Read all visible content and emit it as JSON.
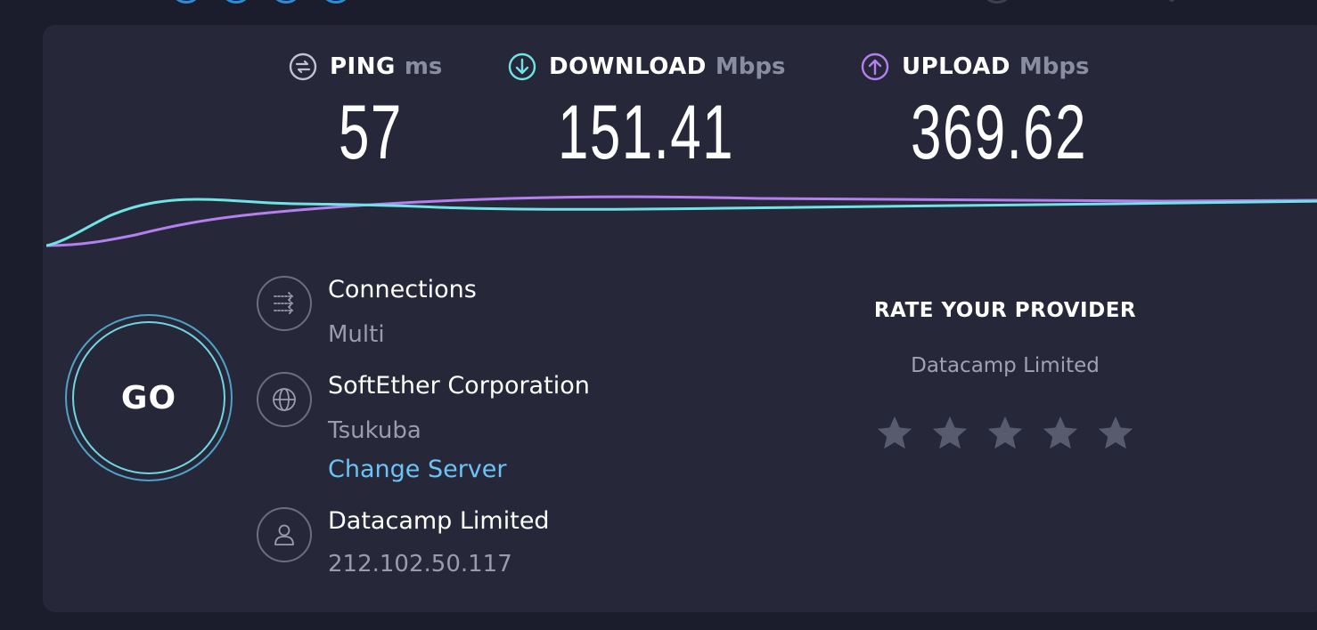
{
  "metrics": {
    "ping": {
      "label": "PING",
      "unit": "ms",
      "value": "57",
      "icon": "ping-icon",
      "color": "#c0c2d0"
    },
    "download": {
      "label": "DOWNLOAD",
      "unit": "Mbps",
      "value": "151.41",
      "icon": "download-arrow-icon",
      "color": "#6fe3e6"
    },
    "upload": {
      "label": "UPLOAD",
      "unit": "Mbps",
      "value": "369.62",
      "icon": "upload-arrow-icon",
      "color": "#b57ff0"
    }
  },
  "go": {
    "label": "GO"
  },
  "connections": {
    "title": "Connections",
    "value": "Multi",
    "icon": "connections-icon"
  },
  "server": {
    "title": "SoftEther Corporation",
    "location": "Tsukuba",
    "change_label": "Change Server",
    "icon": "globe-icon"
  },
  "provider": {
    "title": "Datacamp Limited",
    "ip": "212.102.50.117",
    "icon": "user-icon"
  },
  "rating": {
    "title": "RATE YOUR PROVIDER",
    "provider": "Datacamp Limited",
    "max_stars": 5,
    "selected": 0,
    "star_color": "#585a6e"
  },
  "colors": {
    "accent_link": "#6cc3f5",
    "download_line": "#6fe3e6",
    "upload_line": "#b57ff0",
    "panel_bg": "#262739",
    "page_bg": "#1b1c2c"
  }
}
